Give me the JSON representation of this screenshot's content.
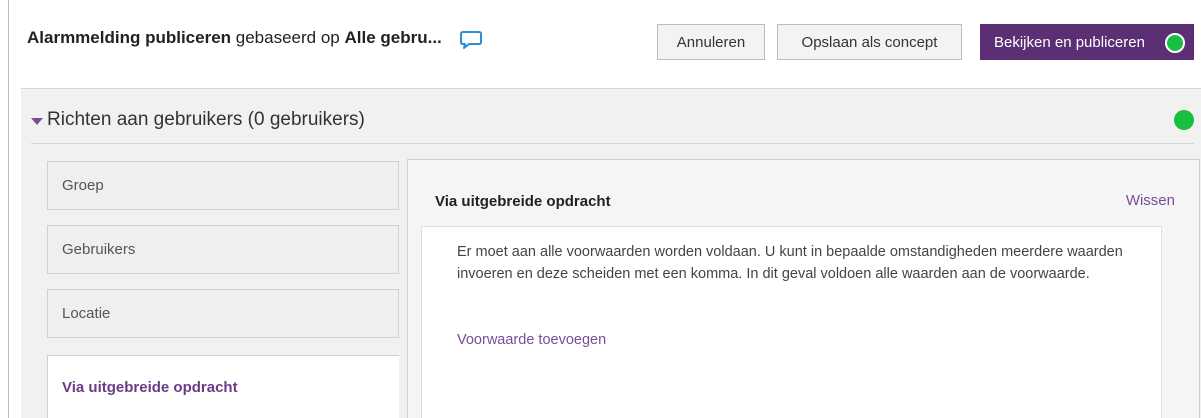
{
  "header": {
    "title_strong1": "Alarmmelding publiceren",
    "title_mid": " gebaseerd op ",
    "title_strong2": "Alle gebru...",
    "chat_icon": "chat-bubble-icon",
    "cancel_label": "Annuleren",
    "draft_label": "Opslaan als concept",
    "publish_label": "Bekijken en publiceren"
  },
  "section": {
    "title": "Richten aan gebruikers (0 gebruikers)",
    "status_color": "#17c043"
  },
  "tabs": [
    {
      "label": "Groep"
    },
    {
      "label": "Gebruikers"
    },
    {
      "label": "Locatie"
    },
    {
      "label": "Via uitgebreide opdracht",
      "active": true
    }
  ],
  "content": {
    "title": "Via uitgebreide opdracht",
    "clear_label": "Wissen",
    "description": "Er moet aan alle voorwaarden worden voldaan. U kunt in bepaalde omstandigheden meerdere waarden invoeren en deze scheiden met een komma. In dit geval voldoen alle waarden aan de voorwaarde.",
    "add_condition_label": "Voorwaarde toevoegen"
  },
  "colors": {
    "accent": "#5c2e74",
    "link": "#7a4d99",
    "success": "#17c043"
  }
}
